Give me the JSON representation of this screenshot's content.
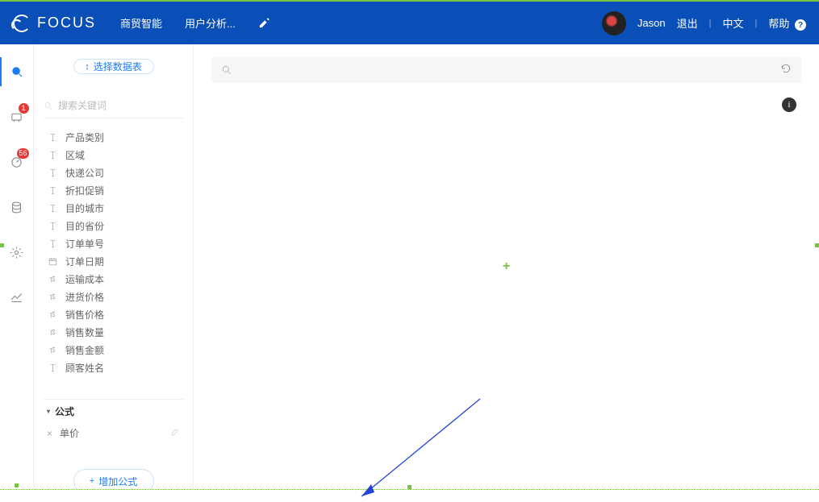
{
  "header": {
    "logo_text": "FOCUS",
    "nav": {
      "item1": "商贸智能",
      "item2": "用户分析..."
    },
    "user_name": "Jason",
    "logout": "退出",
    "lang": "中文",
    "help": "帮助"
  },
  "rail": {
    "badges": {
      "pin": "1",
      "gauge": "56"
    }
  },
  "side": {
    "select_table_btn": "选择数据表",
    "keyword_placeholder": "搜索关键词",
    "fields": [
      {
        "icon": "text",
        "label": "产品类别"
      },
      {
        "icon": "text",
        "label": "区域"
      },
      {
        "icon": "text",
        "label": "快递公司"
      },
      {
        "icon": "text",
        "label": "折扣促销"
      },
      {
        "icon": "text",
        "label": "目的城市"
      },
      {
        "icon": "text",
        "label": "目的省份"
      },
      {
        "icon": "text",
        "label": "订单单号"
      },
      {
        "icon": "date",
        "label": "订单日期"
      },
      {
        "icon": "num",
        "label": "运输成本"
      },
      {
        "icon": "num",
        "label": "进货价格"
      },
      {
        "icon": "num",
        "label": "销售价格"
      },
      {
        "icon": "num",
        "label": "销售数量"
      },
      {
        "icon": "num",
        "label": "销售金额"
      },
      {
        "icon": "text",
        "label": "顾客姓名"
      }
    ],
    "formula_header": "公式",
    "formula_item": "单价",
    "add_formula_btn": "增加公式"
  },
  "main": {
    "search_placeholder": ""
  }
}
